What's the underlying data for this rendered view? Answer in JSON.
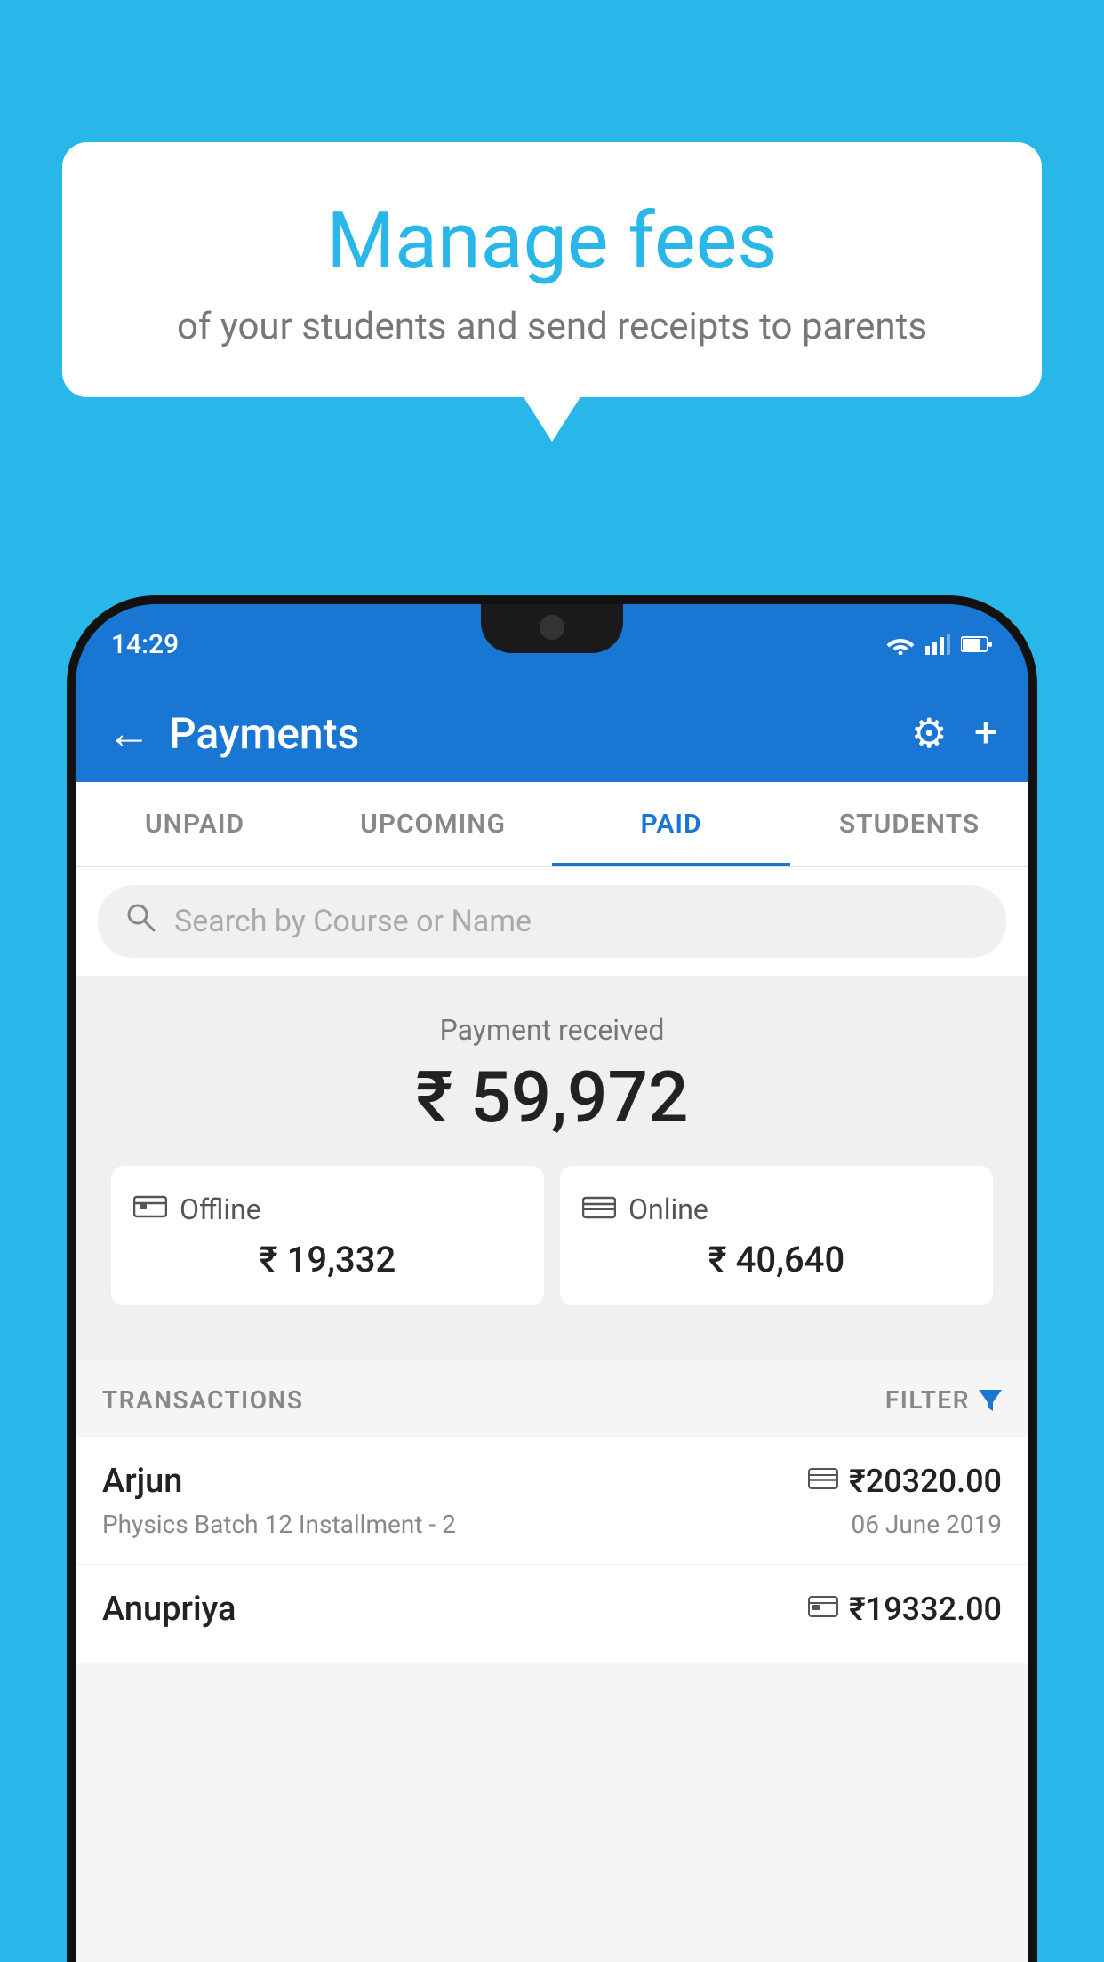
{
  "background_color": "#29b6e8",
  "bubble": {
    "title": "Manage fees",
    "subtitle": "of your students and send receipts to parents"
  },
  "status_bar": {
    "time": "14:29"
  },
  "header": {
    "title": "Payments",
    "back_label": "←",
    "gear_label": "⚙",
    "plus_label": "+"
  },
  "tabs": [
    {
      "label": "UNPAID",
      "active": false
    },
    {
      "label": "UPCOMING",
      "active": false
    },
    {
      "label": "PAID",
      "active": true
    },
    {
      "label": "STUDENTS",
      "active": false
    }
  ],
  "search": {
    "placeholder": "Search by Course or Name"
  },
  "payment_summary": {
    "label": "Payment received",
    "amount": "₹ 59,972"
  },
  "payment_cards": [
    {
      "type": "Offline",
      "amount": "₹ 19,332"
    },
    {
      "type": "Online",
      "amount": "₹ 40,640"
    }
  ],
  "transactions_section": {
    "label": "TRANSACTIONS",
    "filter_label": "FILTER"
  },
  "transactions": [
    {
      "name": "Arjun",
      "course": "Physics Batch 12 Installment - 2",
      "amount": "₹20320.00",
      "date": "06 June 2019",
      "type": "online"
    },
    {
      "name": "Anupriya",
      "course": "",
      "amount": "₹19332.00",
      "date": "",
      "type": "offline"
    }
  ]
}
